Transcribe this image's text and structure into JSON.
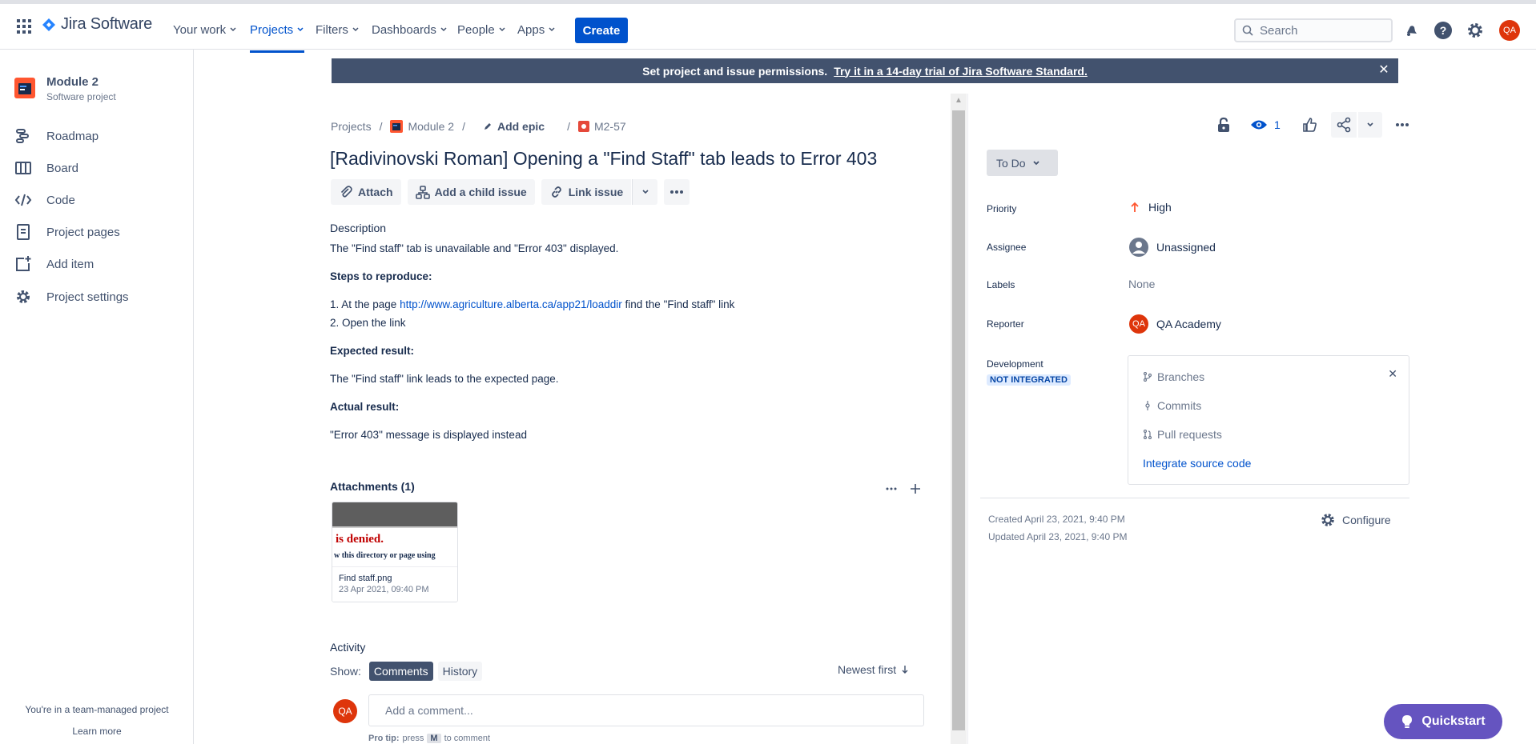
{
  "topnav": {
    "product": "Jira Software",
    "items": [
      "Your work",
      "Projects",
      "Filters",
      "Dashboards",
      "People",
      "Apps"
    ],
    "create": "Create",
    "search_placeholder": "Search",
    "avatar": "QA"
  },
  "sidebar": {
    "project_name": "Module 2",
    "project_type": "Software project",
    "items": [
      {
        "label": "Roadmap",
        "icon": "roadmap-icon"
      },
      {
        "label": "Board",
        "icon": "board-icon"
      },
      {
        "label": "Code",
        "icon": "code-icon"
      },
      {
        "label": "Project pages",
        "icon": "pages-icon"
      },
      {
        "label": "Add item",
        "icon": "add-item-icon"
      },
      {
        "label": "Project settings",
        "icon": "gear-icon"
      }
    ],
    "footer_text": "You're in a team-managed project",
    "footer_link": "Learn more"
  },
  "banner": {
    "text": "Set project and issue permissions.",
    "link": "Try it in a 14-day trial of Jira Software Standard."
  },
  "breadcrumb": {
    "projects": "Projects",
    "project": "Module 2",
    "epic": "Add epic",
    "issue_key": "M2-57"
  },
  "issue": {
    "title": "[Radivinovski Roman] Opening a \"Find Staff\" tab leads to Error 403",
    "actions": {
      "attach": "Attach",
      "child": "Add a child issue",
      "link": "Link issue"
    },
    "description_label": "Description",
    "description": "The \"Find staff\" tab is unavailable and \"Error 403\" displayed.",
    "steps_label": "Steps to reproduce:",
    "step1_pre": "1. At the page",
    "step1_url": "http://www.agriculture.alberta.ca/app21/loaddir",
    "step1_post": "find the \"Find staff\" link",
    "step2": "2. Open the link",
    "expected_label": "Expected result:",
    "expected": "The \"Find staff\" link leads to the expected page.",
    "actual_label": "Actual result:",
    "actual": "\"Error 403\" message is displayed instead"
  },
  "attachments": {
    "heading": "Attachments (1)",
    "file": {
      "preview_line1": "is denied.",
      "preview_line2": "w this directory or page using",
      "name": "Find staff.png",
      "date": "23 Apr 2021, 09:40 PM"
    }
  },
  "activity": {
    "heading": "Activity",
    "show": "Show:",
    "tabs": [
      "Comments",
      "History"
    ],
    "sort": "Newest first",
    "comment_placeholder": "Add a comment...",
    "avatar": "QA",
    "protip_pre": "Pro tip:",
    "protip_press": "press",
    "protip_key": "M",
    "protip_post": "to comment"
  },
  "details": {
    "watchers": "1",
    "status": "To Do",
    "priority_label": "Priority",
    "priority": "High",
    "assignee_label": "Assignee",
    "assignee": "Unassigned",
    "labels_label": "Labels",
    "labels": "None",
    "reporter_label": "Reporter",
    "reporter": "QA Academy",
    "reporter_avatar": "QA",
    "development_label": "Development",
    "development_badge": "NOT INTEGRATED",
    "dev_items": [
      "Branches",
      "Commits",
      "Pull requests"
    ],
    "dev_link": "Integrate source code",
    "created": "Created April 23, 2021, 9:40 PM",
    "updated": "Updated April 23, 2021, 9:40 PM",
    "configure": "Configure"
  },
  "quickstart": "Quickstart",
  "colors": {
    "brand": "#0052cc",
    "banner": "#42526e",
    "quickstart": "#6554c0",
    "avatar": "#de350b"
  }
}
